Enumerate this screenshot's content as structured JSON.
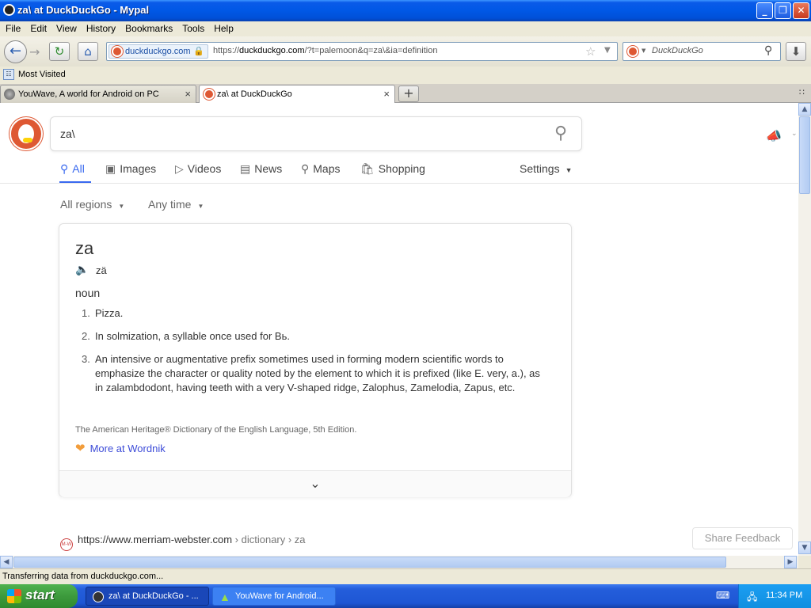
{
  "window": {
    "title": "za\\ at DuckDuckGo - Mypal",
    "minimize": "_",
    "restore": "❐",
    "close": "✕"
  },
  "menu": [
    "File",
    "Edit",
    "View",
    "History",
    "Bookmarks",
    "Tools",
    "Help"
  ],
  "nav": {
    "identity_domain": "duckduckgo.com",
    "url_prefix": "https://",
    "url_host": "duckduckgo.com",
    "url_path": "/?t=palemoon&q=za\\&ia=definition",
    "search_placeholder": "DuckDuckGo"
  },
  "bookmarks": {
    "most_visited": "Most Visited"
  },
  "tabs": [
    {
      "label": "YouWave, A world for Android on PC"
    },
    {
      "label": "za\\ at DuckDuckGo"
    }
  ],
  "page": {
    "query": "za\\",
    "nav_tabs": [
      {
        "label": "All",
        "icon": "search-icon"
      },
      {
        "label": "Images",
        "icon": "image-icon"
      },
      {
        "label": "Videos",
        "icon": "play-icon"
      },
      {
        "label": "News",
        "icon": "news-icon"
      },
      {
        "label": "Maps",
        "icon": "map-pin-icon"
      },
      {
        "label": "Shopping",
        "icon": "bag-icon"
      }
    ],
    "settings": "Settings",
    "filters": {
      "region": "All regions",
      "time": "Any time"
    },
    "definition": {
      "word": "za",
      "pronunciation": "zä",
      "part_of_speech": "noun",
      "senses": [
        "Pizza.",
        "In solmization, a syllable once used for Bь.",
        "An intensive or augmentative prefix sometimes used in forming modern scientific words to emphasize the character or quality noted by the element to which it is prefixed (like E. very, a.), as in zalambdodont, having teeth with a very V-shaped ridge, Zalophus, Zamelodia, Zapus, etc."
      ],
      "source": "The American Heritage® Dictionary of the English Language, 5th Edition.",
      "more_link": "More at Wordnik"
    },
    "result": {
      "url": "https://www.merriam-webster.com",
      "crumbs": "› dictionary › za",
      "favicon": "M-W"
    },
    "share_feedback": "Share Feedback"
  },
  "status": "Transferring data from duckduckgo.com...",
  "taskbar": {
    "start": "start",
    "items": [
      "za\\ at DuckDuckGo - ...",
      "YouWave for Android..."
    ],
    "clock": "11:34 PM"
  },
  "colors": {
    "accent": "#3969ef",
    "ddg_orange": "#de5833",
    "xp_blue": "#0058e6"
  }
}
